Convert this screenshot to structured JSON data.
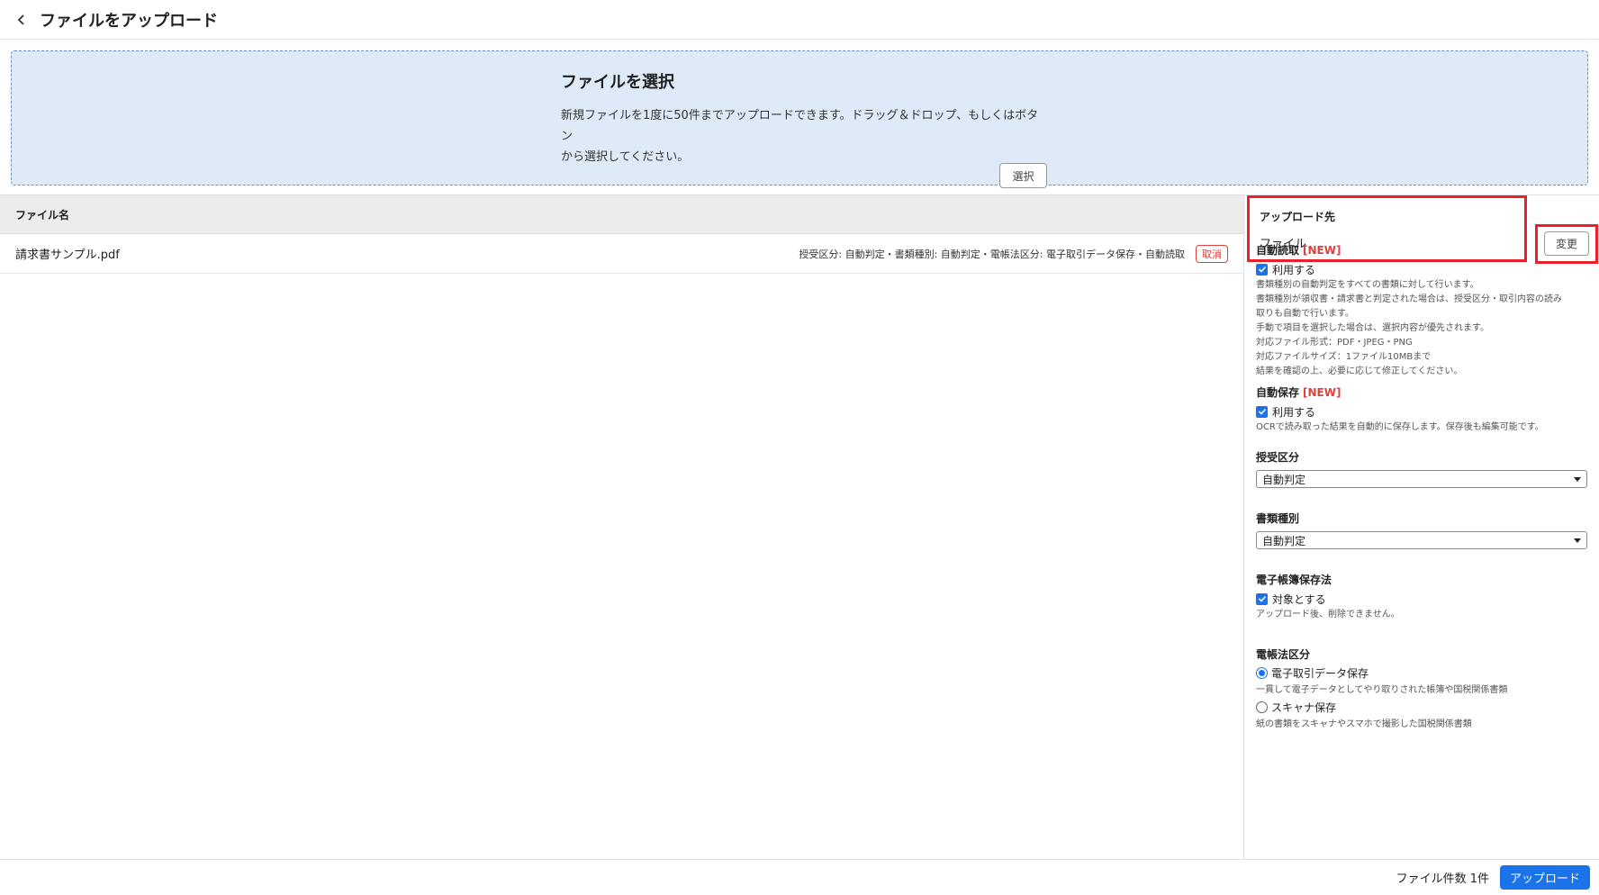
{
  "header": {
    "title": "ファイルをアップロード"
  },
  "dropzone": {
    "title": "ファイルを選択",
    "desc_line1": "新規ファイルを1度に50件までアップロードできます。ドラッグ＆ドロップ、もしくはボタン",
    "desc_line2": "から選択してください。",
    "select_label": "選択"
  },
  "filelist": {
    "column_filename": "ファイル名",
    "rows": [
      {
        "name": "請求書サンプル.pdf",
        "meta": "授受区分: 自動判定・書類種別: 自動判定・電帳法区分: 電子取引データ保存・自動読取",
        "cancel_label": "取消"
      }
    ]
  },
  "panel": {
    "destination": {
      "label": "アップロード先",
      "value": "ファイル",
      "change_label": "変更"
    },
    "auto_read": {
      "title": "自動読取",
      "new_tag": "[NEW]",
      "checkbox_label": "利用する",
      "checked": true,
      "help": [
        "書類種別の自動判定をすべての書類に対して行います。",
        "書類種別が領収書・請求書と判定された場合は、授受区分・取引内容の読み",
        "取りも自動で行います。",
        "手動で項目を選択した場合は、選択内容が優先されます。",
        "対応ファイル形式：PDF・JPEG・PNG",
        "対応ファイルサイズ：1ファイル10MBまで",
        "結果を確認の上、必要に応じて修正してください。"
      ]
    },
    "auto_save": {
      "title": "自動保存",
      "new_tag": "[NEW]",
      "checkbox_label": "利用する",
      "checked": true,
      "help": "OCRで読み取った結果を自動的に保存します。保存後も編集可能です。"
    },
    "juju_kubun": {
      "title": "授受区分",
      "selected": "自動判定"
    },
    "shorui_shubetsu": {
      "title": "書類種別",
      "selected": "自動判定"
    },
    "denshi_chobo": {
      "title": "電子帳簿保存法",
      "checkbox_label": "対象とする",
      "checked": true,
      "help": "アップロード後、削除できません。"
    },
    "dencho_kubun": {
      "title": "電帳法区分",
      "options": [
        {
          "label": "電子取引データ保存",
          "selected": true,
          "help": "一貫して電子データとしてやり取りされた帳簿や国税関係書類"
        },
        {
          "label": "スキャナ保存",
          "selected": false,
          "help": "紙の書類をスキャナやスマホで撮影した国税関係書類"
        }
      ]
    }
  },
  "footer": {
    "count_text": "ファイル件数 1件",
    "upload_label": "アップロード"
  },
  "colors": {
    "accent": "#1a73e8",
    "danger": "#e0403c",
    "highlight": "#e8202a",
    "dropzone_bg": "#dfeaf8"
  }
}
